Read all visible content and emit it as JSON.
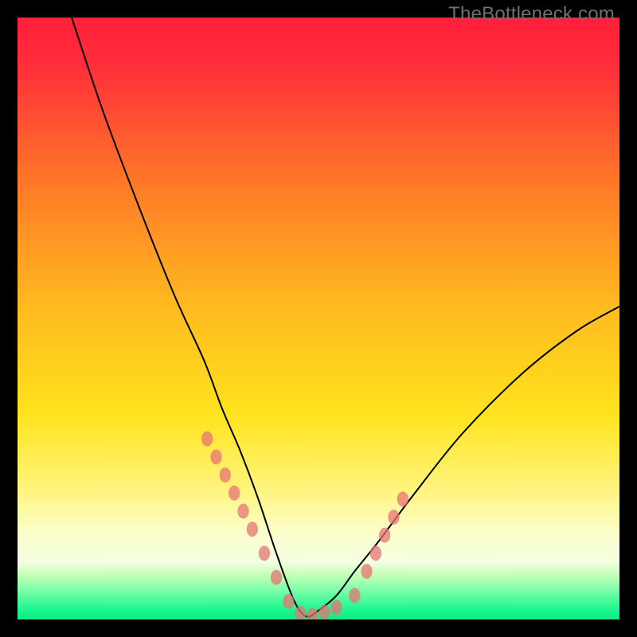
{
  "watermark": "TheBottleneck.com",
  "colors": {
    "top": "#ff1f3a",
    "mid_upper": "#ff8a20",
    "mid": "#ffe31e",
    "lower": "#fff9b0",
    "band_pale_green": "#b8ffb3",
    "bottom": "#14f58b",
    "curve": "#000000",
    "marker": "#e77373",
    "background": "#000000"
  },
  "chart_data": {
    "type": "line",
    "title": "",
    "xlabel": "",
    "ylabel": "",
    "xlim": [
      0,
      100
    ],
    "ylim": [
      0,
      100
    ],
    "grid": false,
    "legend": false,
    "note": "V-shaped bottleneck curve; vertex near x≈48 at y≈0. Left arm starts near (9,100) and descends; right arm rises toward (100,52). Pink markers cluster along lower portions of both arms and along the trough.",
    "series": [
      {
        "name": "bottleneck-curve",
        "x": [
          9,
          14,
          20,
          26,
          31,
          34,
          37,
          40,
          43,
          46,
          48,
          50,
          53,
          56,
          60,
          66,
          74,
          84,
          93,
          100
        ],
        "y": [
          100,
          85,
          69,
          54,
          43,
          35,
          28,
          20,
          11,
          3,
          0.5,
          1.5,
          4,
          8,
          13,
          21,
          31,
          41,
          48,
          52
        ]
      }
    ],
    "markers": {
      "name": "highlight-points",
      "x": [
        31.5,
        33,
        34.5,
        36,
        37.5,
        39,
        41,
        43,
        45,
        47,
        49,
        51,
        53,
        56,
        58,
        59.5,
        61,
        62.5,
        64
      ],
      "y": [
        30,
        27,
        24,
        21,
        18,
        15,
        11,
        7,
        3,
        1,
        0.7,
        1.2,
        2,
        4,
        8,
        11,
        14,
        17,
        20
      ]
    }
  }
}
